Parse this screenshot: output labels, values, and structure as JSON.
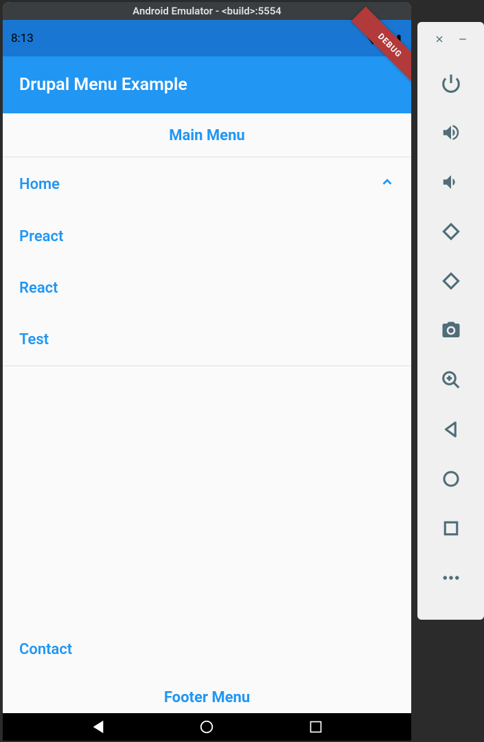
{
  "window": {
    "title": "Android Emulator - <build>:5554"
  },
  "statusBar": {
    "time": "8:13"
  },
  "debugBanner": "DEBUG",
  "appBar": {
    "title": "Drupal Menu Example"
  },
  "mainMenu": {
    "header": "Main Menu",
    "items": [
      {
        "label": "Home",
        "expanded": true
      },
      {
        "label": "Preact"
      },
      {
        "label": "React"
      },
      {
        "label": "Test"
      }
    ]
  },
  "footerMenu": {
    "header": "Footer Menu",
    "items": [
      {
        "label": "Contact"
      }
    ]
  }
}
